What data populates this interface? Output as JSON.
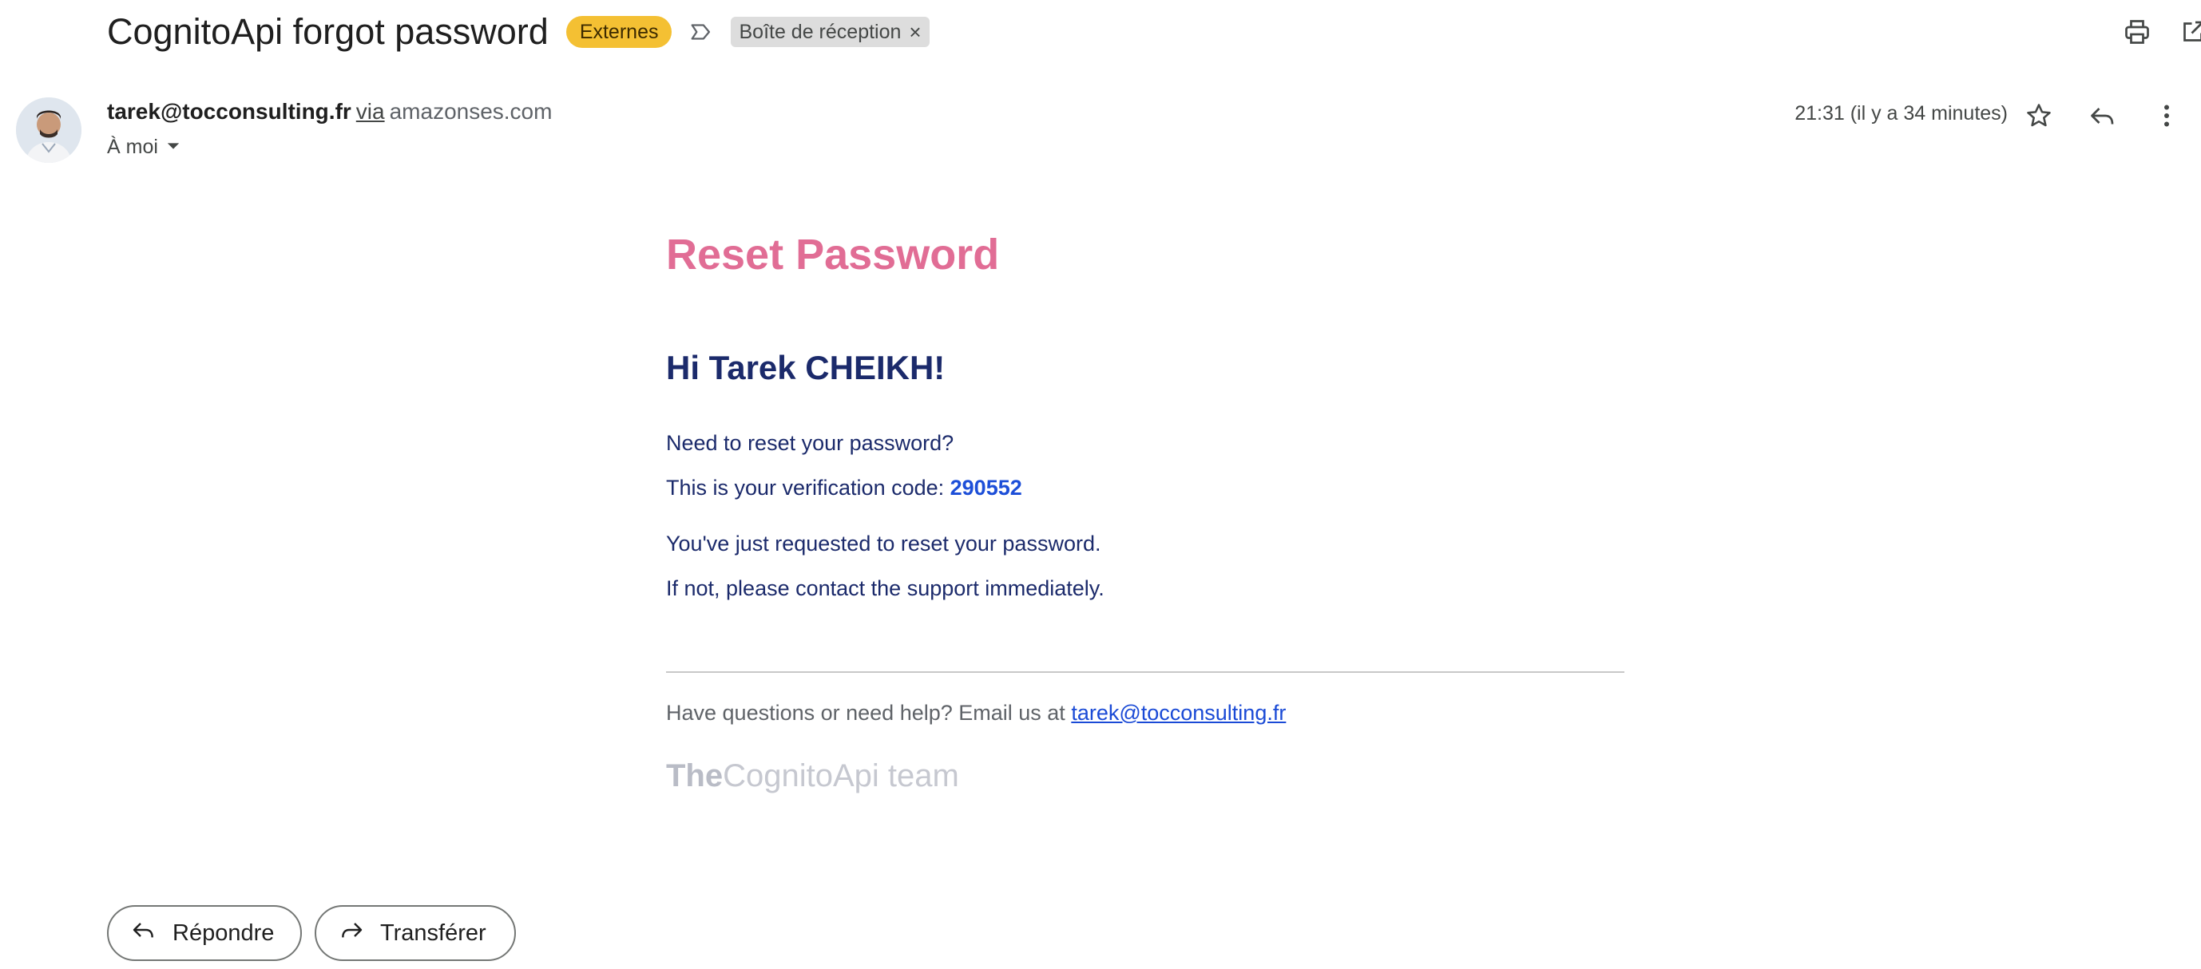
{
  "subject": {
    "title": "CognitoApi forgot password",
    "external_chip": "Externes",
    "inbox_chip": "Boîte de réception",
    "inbox_chip_close": "×"
  },
  "header_actions": {
    "print_icon": "print-icon",
    "open_new_window_icon": "open-in-new-icon"
  },
  "sender": {
    "email": "tarek@tocconsulting.fr",
    "via": "via",
    "domain": "amazonses.com",
    "recipient": "À moi"
  },
  "message_meta": {
    "timestamp": "21:31 (il y a 34 minutes)"
  },
  "email_body": {
    "heading": "Reset Password",
    "greeting": "Hi Tarek CHEIKH!",
    "line_need_reset": "Need to reset your password?",
    "line_code_prefix": "This is your verification code: ",
    "verification_code": "290552",
    "line_requested": "You've just requested to reset your password.",
    "line_contact": "If not, please contact the support immediately.",
    "help_prefix": "Have questions or need help? Email us at ",
    "help_email": "tarek@tocconsulting.fr",
    "signature_the": "The",
    "signature_rest": "CognitoApi team"
  },
  "actions": {
    "reply_label": "Répondre",
    "forward_label": "Transférer"
  },
  "colors": {
    "external_chip": "#f4c033",
    "heading_pink": "#e16d95",
    "navy_text": "#1b2a6b",
    "code_blue": "#1d4fd8",
    "link_blue": "#1a4ad6"
  }
}
